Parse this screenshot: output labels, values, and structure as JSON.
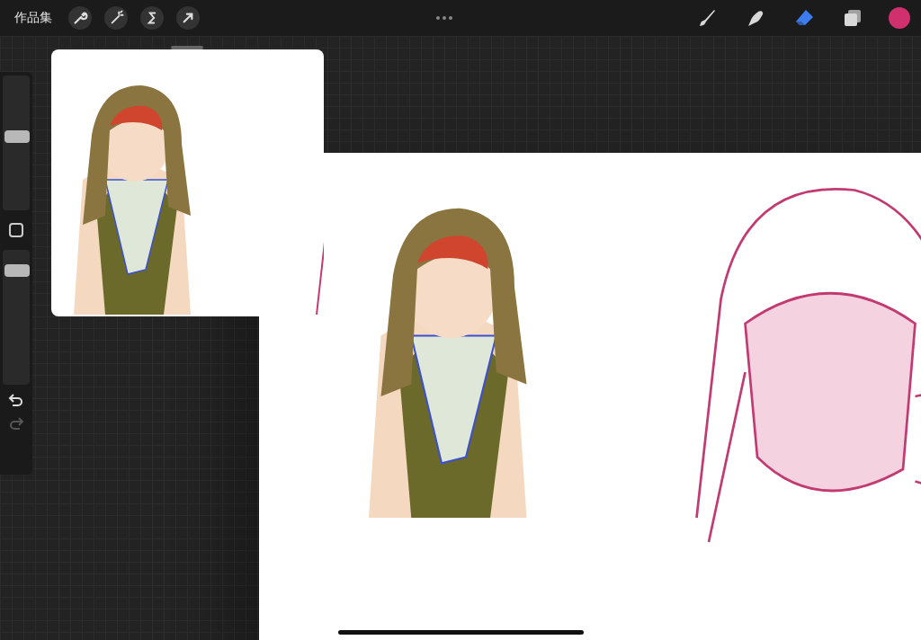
{
  "top_bar": {
    "gallery_label": "作品集",
    "actions": [
      {
        "kind": "wrench"
      },
      {
        "kind": "wand"
      },
      {
        "kind": "selection"
      },
      {
        "kind": "transform"
      }
    ],
    "tools": [
      {
        "kind": "brush",
        "selected": false
      },
      {
        "kind": "smudge",
        "selected": false
      },
      {
        "kind": "eraser",
        "selected": true
      },
      {
        "kind": "layers",
        "selected": false
      }
    ],
    "current_color": {
      "color": "#d0306e"
    }
  },
  "sidebar": {
    "size_slider": {
      "level": 0.55
    },
    "opacity_slider": {
      "level": 0.88
    }
  }
}
